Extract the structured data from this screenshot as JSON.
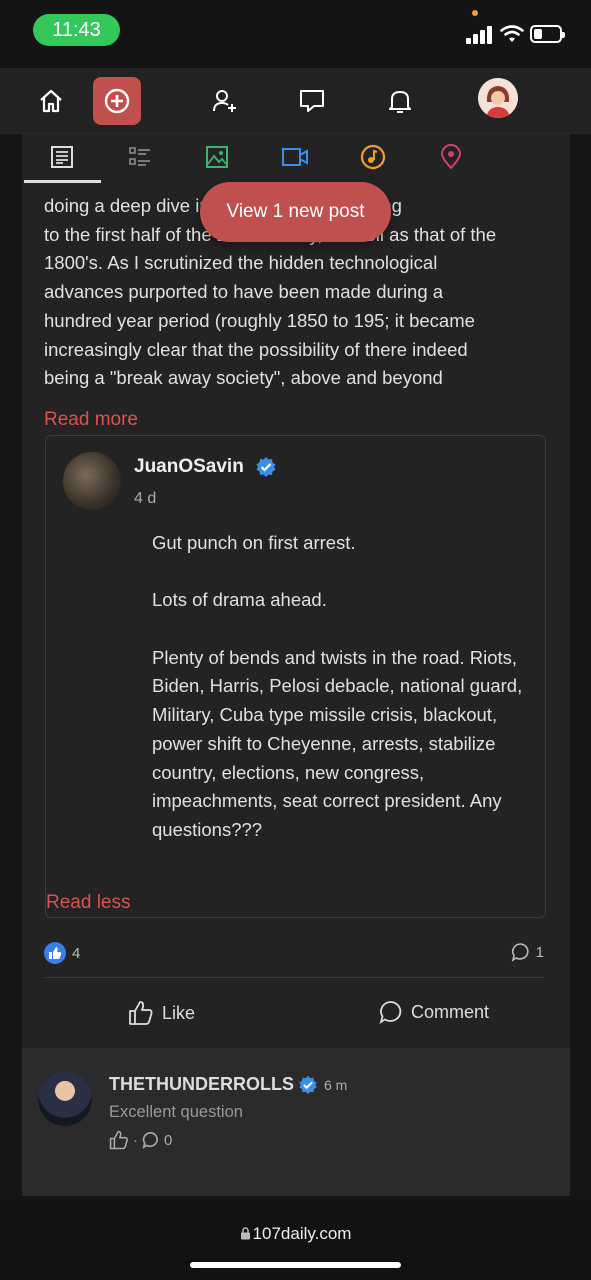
{
  "status_bar": {
    "time": "11:43"
  },
  "top_nav": {
    "items": [
      {
        "icon": "home-icon"
      },
      {
        "icon": "create-post-icon",
        "accent": "#c0504d"
      },
      {
        "icon": "add-friend-icon"
      },
      {
        "icon": "messages-icon"
      },
      {
        "icon": "notifications-icon"
      },
      {
        "icon": "profile-avatar"
      }
    ]
  },
  "post_type_tabs": [
    {
      "icon": "text-post-icon",
      "color": "#dddddd",
      "active": true
    },
    {
      "icon": "list-icon",
      "color": "#888888"
    },
    {
      "icon": "image-icon",
      "color": "#3cb371"
    },
    {
      "icon": "video-icon",
      "color": "#3b8fe6"
    },
    {
      "icon": "music-icon",
      "color": "#f0a030"
    },
    {
      "icon": "location-icon",
      "color": "#d0406a"
    }
  ],
  "toast": {
    "label": "View 1 new post"
  },
  "post": {
    "body_lines": [
      "doing a deep dive into the history pertaining",
      "to the first half of the 20th century, as well as that of the",
      "1800's. As I scrutinized the hidden technological",
      "advances purported to have been made during a",
      "hundred year period (roughly 1850 to 195; it became",
      "increasingly clear that the possibility of there indeed",
      "being a \"break away society\", above and beyond"
    ],
    "read_more": "Read more",
    "shared": {
      "author": "JuanOSavin",
      "age": "4 d",
      "paragraphs": [
        "Gut punch on first arrest.",
        "Lots of drama ahead.",
        "Plenty of bends and twists in the road. Riots, Biden, Harris, Pelosi debacle, national guard, Military, Cuba type missile crisis, blackout, power shift to Cheyenne, arrests, stabilize country, elections, new congress, impeachments, seat correct president. Any questions???"
      ],
      "read_less": "Read less"
    },
    "like_count": "4",
    "comment_count": "1",
    "like_label": "Like",
    "comment_label": "Comment"
  },
  "comment": {
    "author": "THETHUNDERROLLS",
    "time": "6 m",
    "text": "Excellent question",
    "like_sep": "·",
    "reply_count": "0"
  },
  "browser": {
    "url": "107daily.com"
  },
  "colors": {
    "accent": "#c0504d",
    "link": "#d9534f",
    "verified": "#3b8fe6"
  }
}
